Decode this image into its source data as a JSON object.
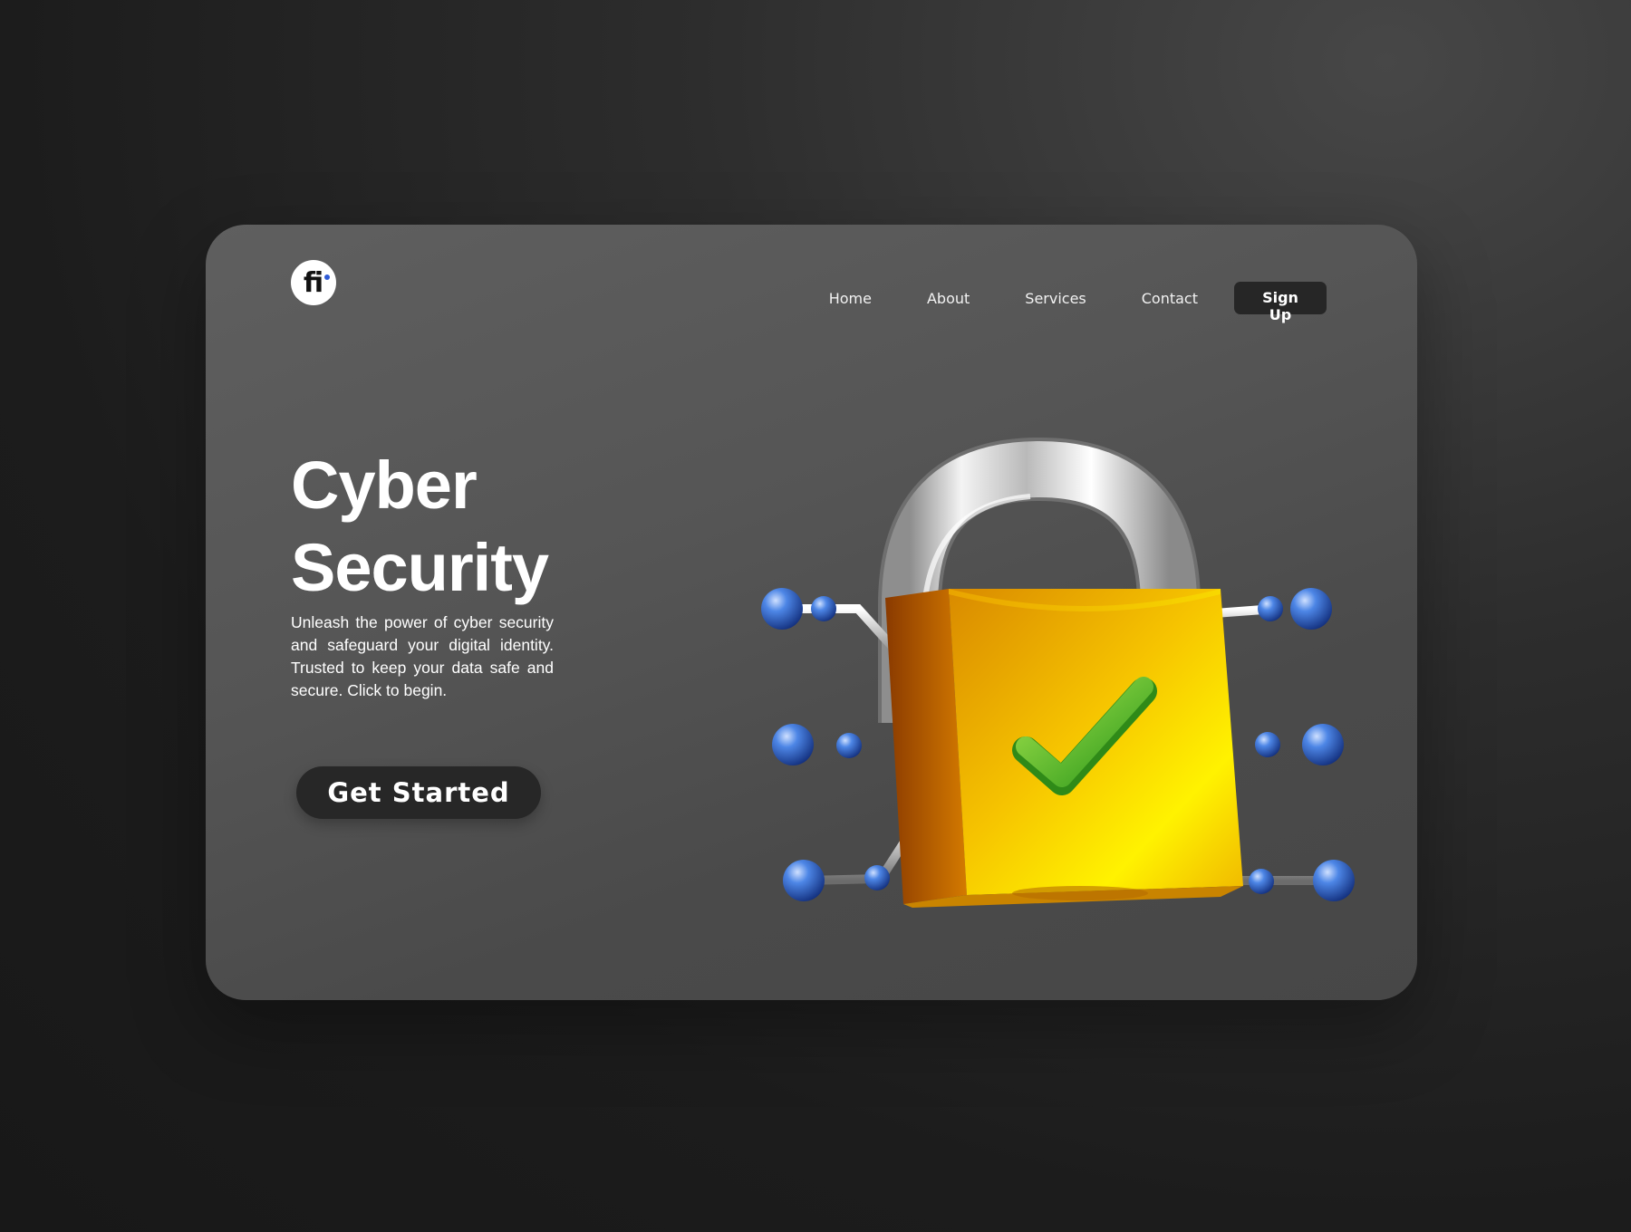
{
  "brand": {
    "logo_text": "fi"
  },
  "nav": {
    "items": [
      {
        "label": "Home"
      },
      {
        "label": "About"
      },
      {
        "label": "Services"
      },
      {
        "label": "Contact"
      }
    ],
    "signup_label": "Sign Up"
  },
  "hero": {
    "title_line1": "Cyber",
    "title_line2": "Security",
    "description": "Unleash the power of cyber security and safeguard your digital identity. Trusted to keep your data safe and secure. Click to begin.",
    "cta_label": "Get Started"
  },
  "illustration": {
    "icon": "padlock-check-icon"
  },
  "colors": {
    "background": "#1c1c1c",
    "card": "#555555",
    "button": "#262626",
    "lock_gold": "#f2c200",
    "check_green": "#4fc326",
    "node_blue": "#2f5fc8"
  }
}
